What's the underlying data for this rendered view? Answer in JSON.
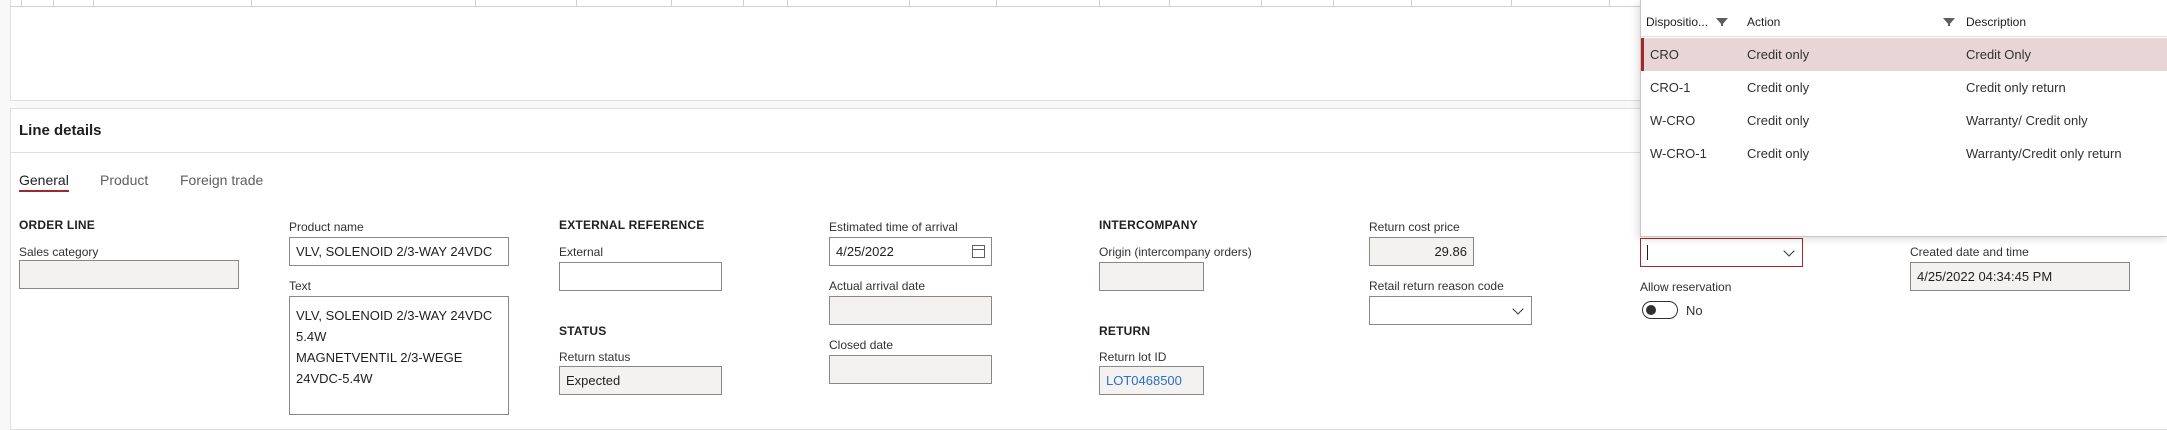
{
  "details": {
    "title": "Line details",
    "tabs": [
      "General",
      "Product",
      "Foreign trade"
    ]
  },
  "order_line": {
    "heading": "ORDER LINE",
    "sales_category_label": "Sales category",
    "sales_category_value": ""
  },
  "product": {
    "name_label": "Product name",
    "name_value": "VLV, SOLENOID 2/3-WAY 24VDC",
    "text_label": "Text",
    "text_value": "VLV, SOLENOID 2/3-WAY 24VDC\n5.4W\nMAGNETVENTIL 2/3-WEGE\n24VDC-5.4W"
  },
  "external_reference": {
    "heading": "EXTERNAL REFERENCE",
    "external_label": "External",
    "external_value": ""
  },
  "status": {
    "heading": "STATUS",
    "return_status_label": "Return status",
    "return_status_value": "Expected"
  },
  "dates": {
    "eta_label": "Estimated time of arrival",
    "eta_value": "4/25/2022",
    "actual_arrival_label": "Actual arrival date",
    "actual_arrival_value": "",
    "closed_label": "Closed date",
    "closed_value": ""
  },
  "intercompany": {
    "heading": "INTERCOMPANY",
    "origin_label": "Origin (intercompany orders)",
    "origin_value": ""
  },
  "return": {
    "heading": "RETURN",
    "lot_label": "Return lot ID",
    "lot_value": "LOT0468500"
  },
  "costs": {
    "return_cost_label": "Return cost price",
    "return_cost_value": "29.86",
    "retail_reason_label": "Retail return reason code",
    "retail_reason_value": ""
  },
  "disposition": {
    "input_value": "",
    "allow_reservation_label": "Allow reservation",
    "allow_reservation_value": "No"
  },
  "created": {
    "label": "Created date and time",
    "value": "4/25/2022 04:34:45 PM"
  },
  "lookup": {
    "headers": {
      "disposition": "Dispositio...",
      "action": "Action",
      "description": "Description"
    },
    "rows": [
      {
        "code": "CRO",
        "action": "Credit only",
        "description": "Credit Only",
        "selected": true
      },
      {
        "code": "CRO-1",
        "action": "Credit only",
        "description": "Credit only return",
        "selected": false
      },
      {
        "code": "W-CRO",
        "action": "Credit only",
        "description": "Warranty/ Credit only",
        "selected": false
      },
      {
        "code": "W-CRO-1",
        "action": "Credit only",
        "description": "Warranty/Credit only return",
        "selected": false
      }
    ]
  },
  "colors": {
    "accent": "#a4262c",
    "selected_row": "#e8d6d7",
    "link": "#2f6fc0"
  }
}
